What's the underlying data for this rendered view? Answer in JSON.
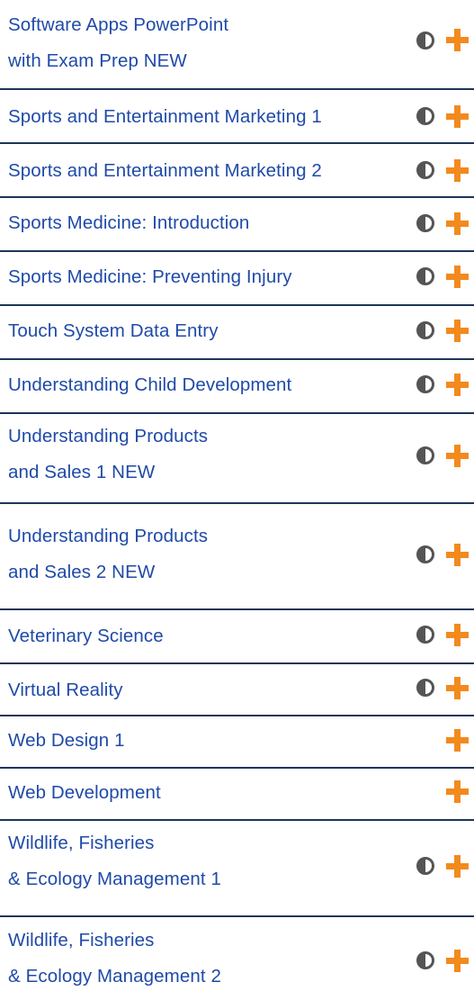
{
  "colors": {
    "link": "#1f4aa8",
    "separator": "#1f3559",
    "plus": "#f28a1e",
    "half_icon": "#555555"
  },
  "icons": {
    "half": "half-circle-icon",
    "add": "plus-icon"
  },
  "courses": [
    {
      "line1": "Software Apps PowerPoint",
      "line2": "with Exam Prep NEW",
      "has_half_icon": true
    },
    {
      "line1": "Sports and Entertainment Marketing 1",
      "line2": "",
      "has_half_icon": true
    },
    {
      "line1": "Sports and Entertainment Marketing 2",
      "line2": "",
      "has_half_icon": true
    },
    {
      "line1": "Sports Medicine: Introduction",
      "line2": "",
      "has_half_icon": true
    },
    {
      "line1": "Sports Medicine: Preventing Injury",
      "line2": "",
      "has_half_icon": true
    },
    {
      "line1": "Touch System Data Entry",
      "line2": "",
      "has_half_icon": true
    },
    {
      "line1": "Understanding Child Development",
      "line2": "",
      "has_half_icon": true
    },
    {
      "line1": "Understanding Products",
      "line2": "and Sales 1 NEW",
      "has_half_icon": true
    },
    {
      "line1": "Understanding Products",
      "line2": "and Sales 2 NEW",
      "has_half_icon": true
    },
    {
      "line1": "Veterinary Science",
      "line2": "",
      "has_half_icon": true
    },
    {
      "line1": "Virtual Reality",
      "line2": "",
      "has_half_icon": true
    },
    {
      "line1": "Web Design 1",
      "line2": "",
      "has_half_icon": false
    },
    {
      "line1": "Web Development",
      "line2": "",
      "has_half_icon": false
    },
    {
      "line1": "Wildlife, Fisheries",
      "line2": "& Ecology Management 1",
      "has_half_icon": true
    },
    {
      "line1": "Wildlife, Fisheries",
      "line2": "& Ecology Management 2",
      "has_half_icon": true
    }
  ]
}
